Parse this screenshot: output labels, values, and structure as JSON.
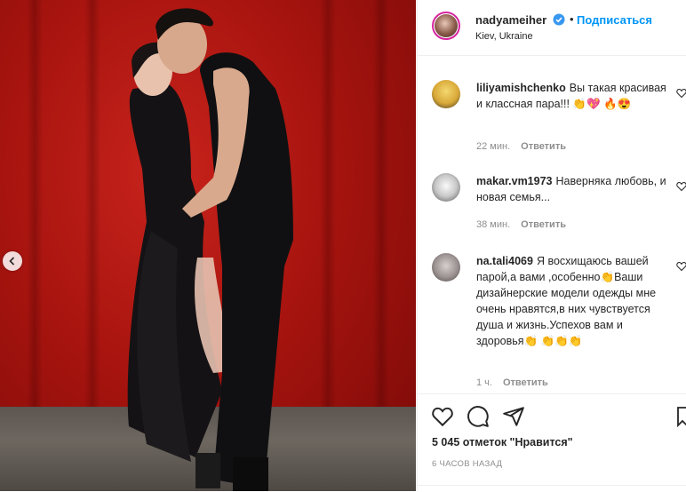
{
  "post": {
    "author": "nadyameiher",
    "location": "Kiev, Ukraine",
    "follow_label": "Подписаться",
    "dot": "•",
    "photo_alt": "Couple posing in black outfits against red drapery"
  },
  "comments": [
    {
      "user": "liliyamishchenko",
      "text": "Вы такая красивая и классная пара!!! 👏💖 🔥😍",
      "time": "22 мин.",
      "reply": "Ответить"
    },
    {
      "user": "makar.vm1973",
      "text": "Наверняка любовь, и новая семья...",
      "time": "38 мин.",
      "reply": "Ответить"
    },
    {
      "user": "na.tali4069",
      "text": "Я восхищаюсь вашей парой,а вами ,особенно👏Ваши дизайнерские модели одежды мне очень нравятся,в них чувствуется душа и жизнь.Успехов вам и здоровья👏 👏👏👏",
      "time": "1 ч.",
      "reply": "Ответить"
    }
  ],
  "footer": {
    "likes": "5 045 отметок \"Нравится\"",
    "posted": "6 ЧАСОВ НАЗАД"
  },
  "icons": {
    "verified": "verified-badge-icon",
    "heart": "heart-icon",
    "comment": "comment-icon",
    "share": "share-icon",
    "save": "bookmark-icon",
    "prev": "chevron-left-icon"
  },
  "colors": {
    "accent": "#0095f6",
    "curtain": "#b3170f"
  }
}
